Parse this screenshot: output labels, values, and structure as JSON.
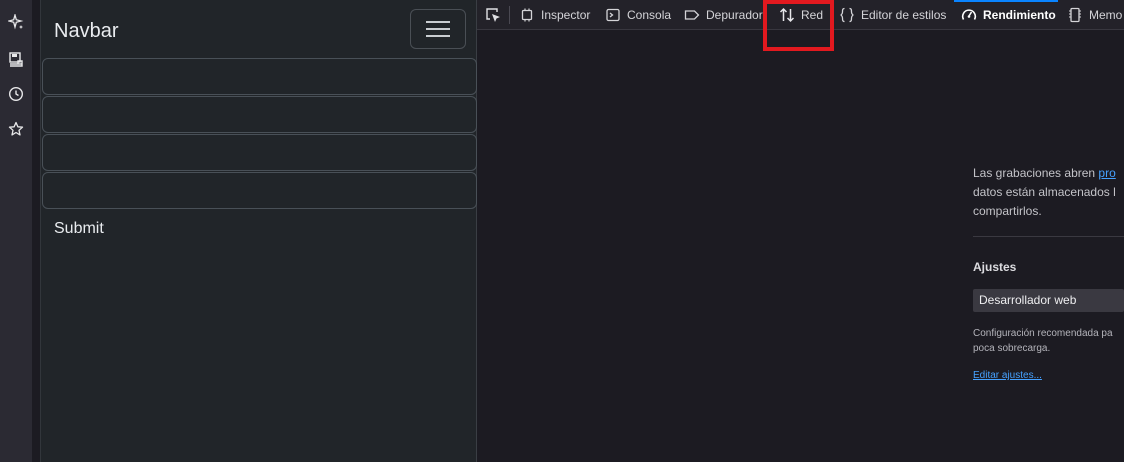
{
  "rail": {
    "icons": [
      "sparkle-icon",
      "floppy-icon",
      "clock-icon",
      "star-icon"
    ]
  },
  "page": {
    "brand": "Navbar",
    "submit_label": "Submit"
  },
  "devtools": {
    "tabs": [
      {
        "label": "Inspector",
        "icon": "inspector-icon"
      },
      {
        "label": "Consola",
        "icon": "console-icon"
      },
      {
        "label": "Depurador",
        "icon": "debugger-icon"
      },
      {
        "label": "Red",
        "icon": "network-icon"
      },
      {
        "label": "Editor de estilos",
        "icon": "braces-icon"
      },
      {
        "label": "Rendimiento",
        "icon": "gauge-icon",
        "active": true
      },
      {
        "label": "Memo",
        "icon": "memory-icon"
      }
    ],
    "highlight_color": "#e2191f",
    "accent_color": "#0a84ff",
    "performance": {
      "desc_before_link": "Las grabaciones abren ",
      "desc_link": "pro",
      "desc_line2": "datos están almacenados l",
      "desc_line3": "compartirlos.",
      "settings_heading": "Ajustes",
      "preset_value": "Desarrollador web",
      "hint_line1": "Configuración recomendada pa",
      "hint_line2": "poca sobrecarga.",
      "edit_link": "Editar ajustes..."
    }
  }
}
